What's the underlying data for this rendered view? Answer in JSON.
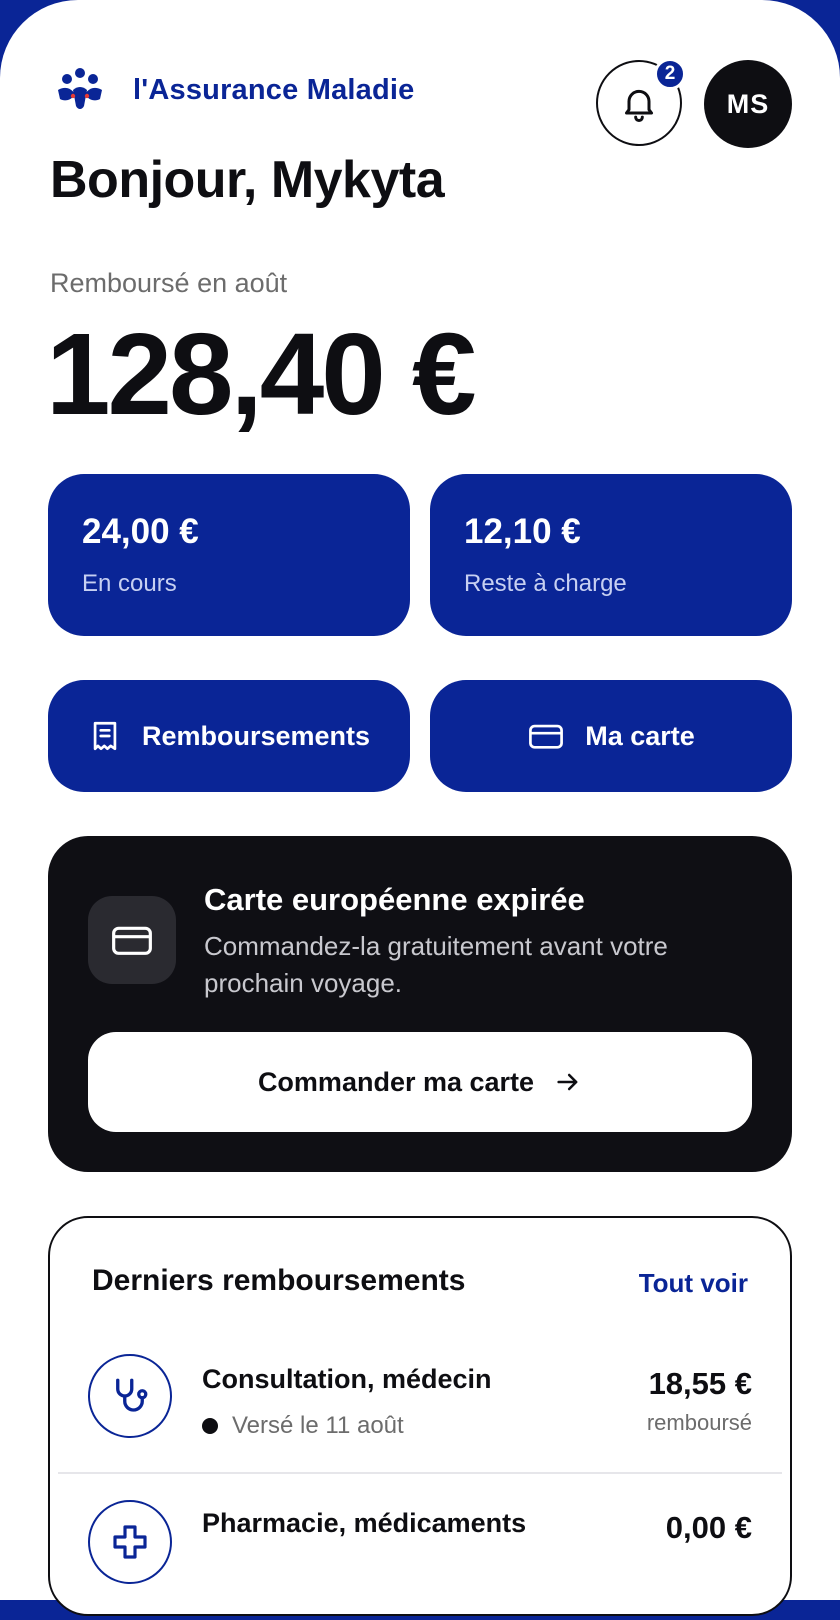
{
  "header": {
    "brand": "l'Assurance Maladie",
    "notification_count": "2",
    "avatar_initials": "MS"
  },
  "greeting": "Bonjour, Mykyta",
  "summary": {
    "period_label": "Remboursé en août",
    "amount": "128,40 €"
  },
  "stats": [
    {
      "value": "24,00 €",
      "label": "En cours"
    },
    {
      "value": "12,10 €",
      "label": "Reste à charge"
    }
  ],
  "actions": {
    "reimbursements": "Remboursements",
    "card": "Ma carte"
  },
  "promo": {
    "title": "Carte européenne expirée",
    "text": "Commandez-la gratuitement avant votre prochain voyage.",
    "button": "Commander ma carte"
  },
  "recent": {
    "title": "Derniers remboursements",
    "link": "Tout voir",
    "items": [
      {
        "title": "Consultation, médecin",
        "status": "Versé le 11 août",
        "amount": "18,55 €",
        "amount_label": "remboursé",
        "icon": "stethoscope-icon"
      },
      {
        "title": "Pharmacie, médicaments",
        "amount": "0,00 €",
        "icon": "medical-cross-icon"
      }
    ]
  },
  "colors": {
    "primary": "#0a2596",
    "dark": "#0f0f14",
    "muted": "#6c6c6c"
  }
}
